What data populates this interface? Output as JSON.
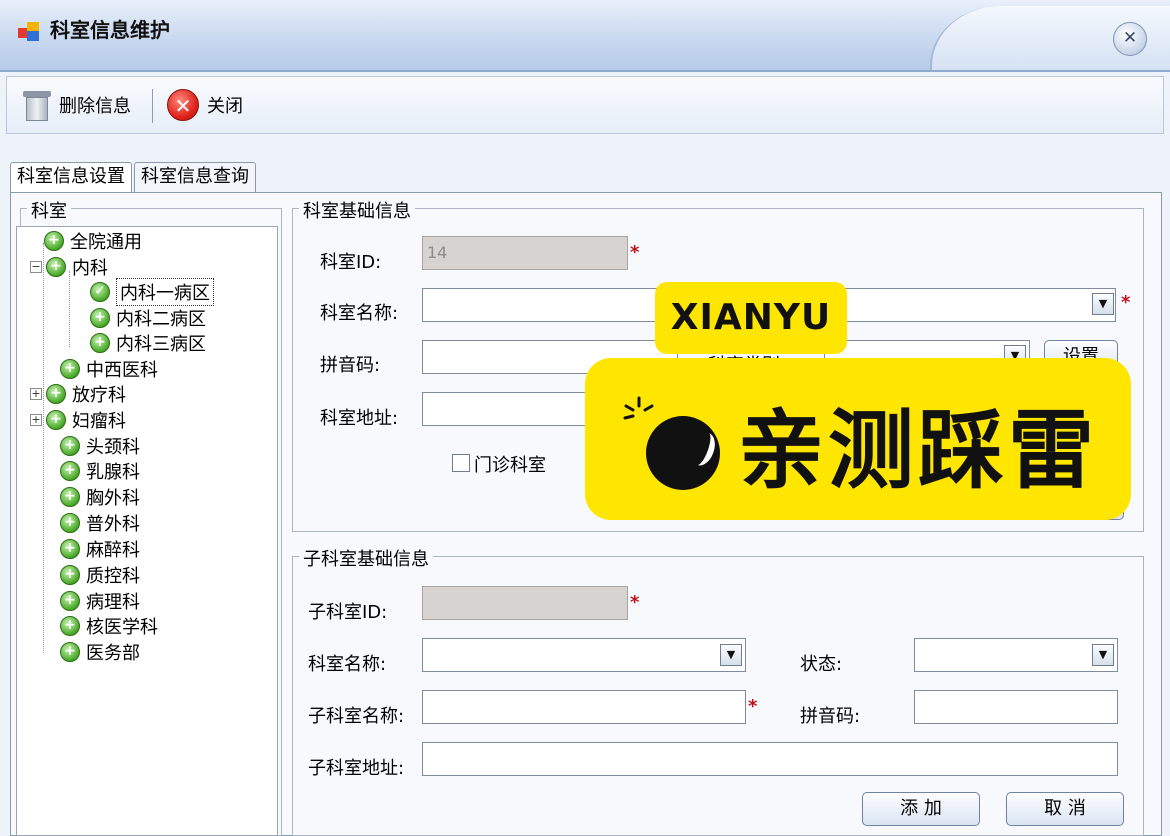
{
  "window": {
    "title": "科室信息维护"
  },
  "toolbar": {
    "delete_label": "删除信息",
    "close_label": "关闭"
  },
  "tabs": [
    {
      "label": "科室信息设置",
      "active": true
    },
    {
      "label": "科室信息查询",
      "active": false
    }
  ],
  "tree": {
    "group_label": "科室",
    "items": [
      {
        "label": "全院通用"
      },
      {
        "label": "内科",
        "expanded": true
      },
      {
        "label": "内科一病区",
        "selected": true
      },
      {
        "label": "内科二病区"
      },
      {
        "label": "内科三病区"
      },
      {
        "label": "中西医科"
      },
      {
        "label": "放疗科",
        "expandable": true
      },
      {
        "label": "妇瘤科",
        "expandable": true
      },
      {
        "label": "头颈科"
      },
      {
        "label": "乳腺科"
      },
      {
        "label": "胸外科"
      },
      {
        "label": "普外科"
      },
      {
        "label": "麻醉科"
      },
      {
        "label": "质控科"
      },
      {
        "label": "病理科"
      },
      {
        "label": "核医学科"
      },
      {
        "label": "医务部"
      }
    ]
  },
  "dept_basic": {
    "group_label": "科室基础信息",
    "id_label": "科室ID:",
    "id_value": "14",
    "name_label": "科室名称:",
    "pinyin_label": "拼音码:",
    "type_label": "科室类别:",
    "settings_button": "设置",
    "address_label": "科室地址:",
    "outpatient_label": "门诊科室"
  },
  "sub_dept": {
    "group_label": "子科室基础信息",
    "id_label": "子科室ID:",
    "name_label": "科室名称:",
    "status_label": "状态:",
    "subname_label": "子科室名称:",
    "pinyin_label": "拼音码:",
    "address_label": "子科室地址:",
    "add_button": "添 加",
    "cancel_button": "取 消"
  },
  "overlay": {
    "tag": "XIANYU",
    "text": "亲测踩雷"
  },
  "colors": {
    "sticker": "#ffe600",
    "required": "#c0121a",
    "tree_node": "#4fae2e"
  }
}
